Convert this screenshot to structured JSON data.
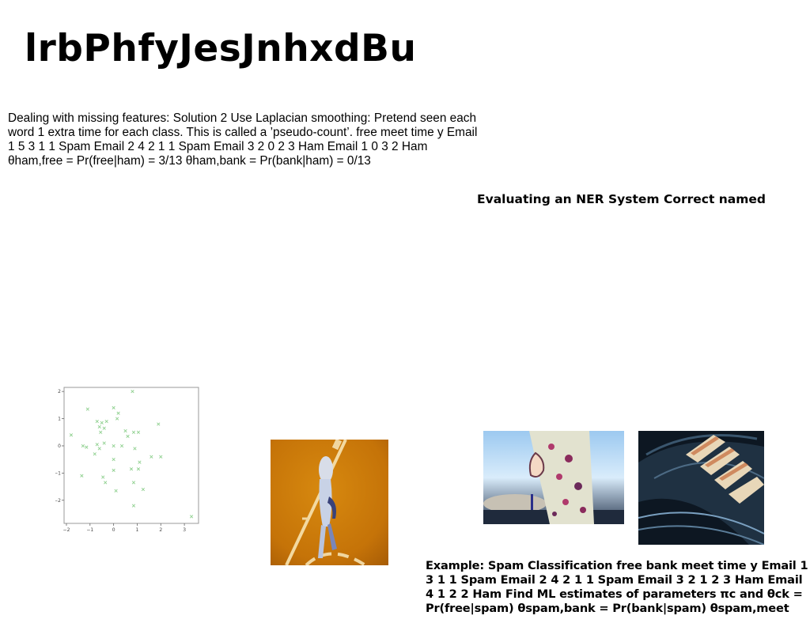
{
  "title": "lrbPhfyJesJnhxdBu",
  "paragraph": "Dealing with missing features: Solution 2 Use Laplacian smoothing: Pretend seen each word 1 extra time for each class. This is called a ’pseudo-count’. free meet time y Email 1 5 3 1 1 Spam Email 2 4 2 1 1 Spam Email 3 2 0 2 3 Ham Email 1 0 3 2 Ham θham,free = Pr(free|ham) = 3/13 θham,bank = Pr(bank|ham) = 0/13",
  "subheading": "Evaluating an NER System Correct named",
  "bottom_text": "Example: Spam Classification free bank meet time y Email 1 3 1 1 Spam Email 2 4 2 1 1 Spam Email 3 2 1 2 3 Ham Email 4 1 2 2 Ham Find ML estimates of parameters πc and θck = Pr(free|spam) θspam,bank = Pr(bank|spam) θspam,meet",
  "chart_data": {
    "type": "scatter",
    "title": "",
    "xlabel": "",
    "ylabel": "",
    "xlim": [
      -2.1,
      3.6
    ],
    "ylim": [
      -2.85,
      2.15
    ],
    "xticks": [
      -2,
      -1,
      0,
      1,
      2,
      3
    ],
    "yticks": [
      2,
      1,
      0,
      -1,
      -2
    ],
    "marker": "x",
    "color": "#8fd08f",
    "grid": false,
    "points": [
      [
        0.8,
        2.0
      ],
      [
        -1.1,
        1.35
      ],
      [
        0.0,
        1.4
      ],
      [
        0.2,
        1.2
      ],
      [
        0.15,
        1.0
      ],
      [
        -0.7,
        0.9
      ],
      [
        -0.5,
        0.85
      ],
      [
        -0.3,
        0.9
      ],
      [
        -0.6,
        0.7
      ],
      [
        -0.4,
        0.65
      ],
      [
        -0.55,
        0.5
      ],
      [
        0.5,
        0.55
      ],
      [
        0.85,
        0.5
      ],
      [
        1.05,
        0.5
      ],
      [
        1.9,
        0.8
      ],
      [
        -1.8,
        0.4
      ],
      [
        0.6,
        0.35
      ],
      [
        -1.3,
        0.0
      ],
      [
        -1.15,
        -0.05
      ],
      [
        -0.7,
        0.05
      ],
      [
        -0.4,
        0.1
      ],
      [
        -0.6,
        -0.1
      ],
      [
        0.0,
        0.0
      ],
      [
        0.35,
        0.0
      ],
      [
        0.9,
        -0.1
      ],
      [
        1.6,
        -0.4
      ],
      [
        2.0,
        -0.4
      ],
      [
        -0.8,
        -0.3
      ],
      [
        0.0,
        -0.5
      ],
      [
        1.1,
        -0.6
      ],
      [
        0.75,
        -0.85
      ],
      [
        1.05,
        -0.85
      ],
      [
        0.0,
        -0.9
      ],
      [
        -1.35,
        -1.1
      ],
      [
        -0.45,
        -1.15
      ],
      [
        -0.35,
        -1.35
      ],
      [
        0.85,
        -1.35
      ],
      [
        1.25,
        -1.6
      ],
      [
        0.1,
        -1.65
      ],
      [
        0.85,
        -2.2
      ],
      [
        3.3,
        -2.6
      ]
    ]
  },
  "images": {
    "gymnast": "gymnast-photo",
    "kimono": "kimono-photo",
    "ceiling": "skylight-ceiling-photo"
  }
}
